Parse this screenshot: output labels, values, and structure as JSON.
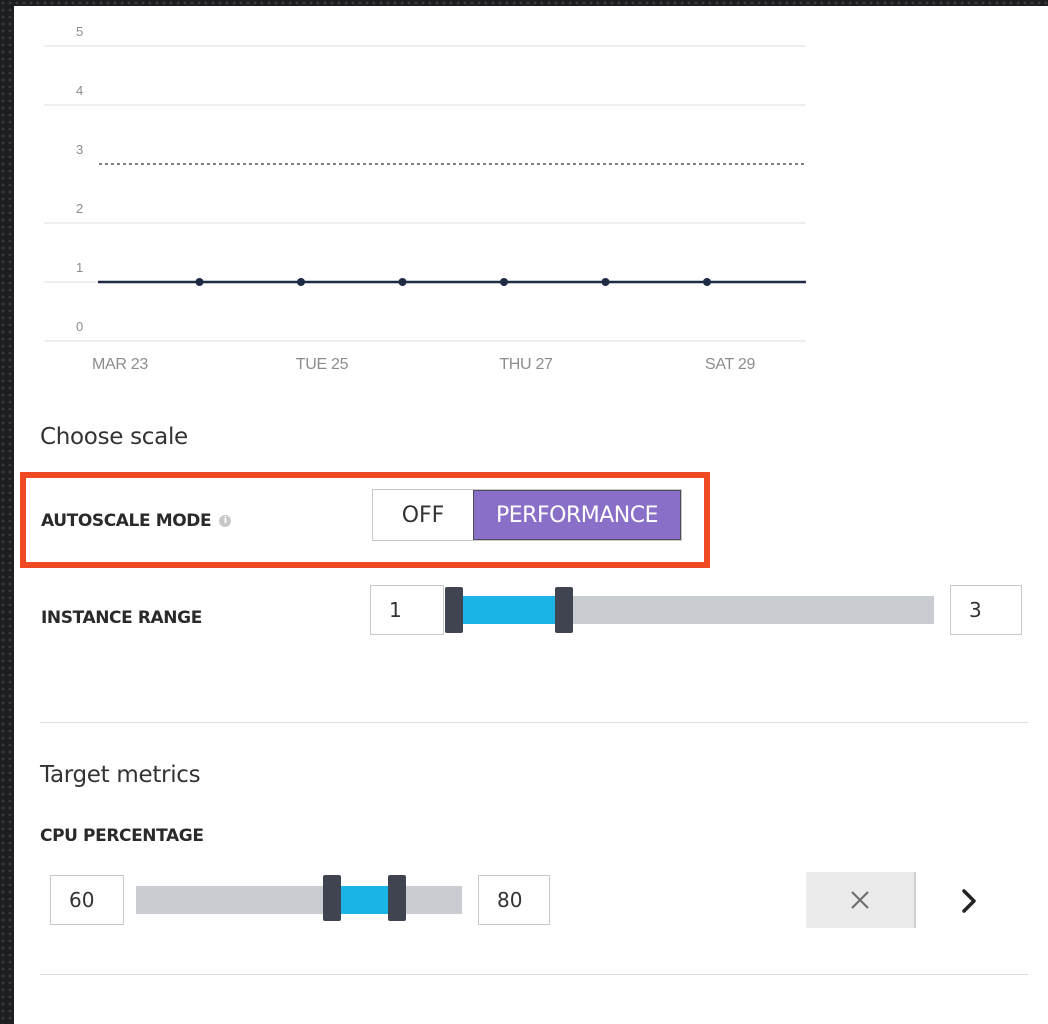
{
  "chart_data": {
    "type": "line",
    "x_ticks": [
      "MAR 23",
      "TUE 25",
      "THU 27",
      "SAT 29"
    ],
    "y_ticks": [
      "5",
      "4",
      "3",
      "2",
      "1",
      "0"
    ],
    "ylim": [
      0,
      5
    ],
    "threshold_line": {
      "value": 3,
      "style": "dashed"
    },
    "series": [
      {
        "values": [
          1,
          1,
          1,
          1,
          1,
          1,
          1,
          1
        ]
      }
    ],
    "grid": true,
    "colors": {
      "series": "#1f2a44",
      "grid": "#dedede",
      "threshold": "#555555"
    }
  },
  "choose_scale": {
    "title": "Choose scale",
    "autoscale_mode": {
      "label": "AUTOSCALE MODE",
      "info_icon": "info-icon",
      "options": [
        "OFF",
        "PERFORMANCE"
      ],
      "selected": "PERFORMANCE",
      "accent": "#8a6fc8",
      "highlight_color": "#f04a23"
    },
    "instance_range": {
      "label": "INSTANCE RANGE",
      "min_value": "1",
      "max_value": "3",
      "selected_fraction_start": 0,
      "selected_fraction_end": 0.23
    }
  },
  "target_metrics": {
    "title": "Target metrics",
    "cpu": {
      "label": "CPU PERCENTAGE",
      "min_value": "60",
      "max_value": "80",
      "selected_fraction_start": 0.6,
      "selected_fraction_end": 0.8,
      "clear_icon": "close-icon",
      "next_icon": "chevron-right-icon"
    }
  }
}
